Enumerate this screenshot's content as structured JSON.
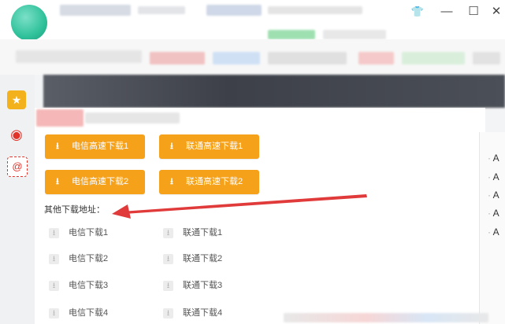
{
  "window": {
    "minimize": "—",
    "maximize": "☐",
    "close": "✕",
    "skin": "👕"
  },
  "rail": {
    "favorites_icon": "star-icon",
    "weibo_icon": "weibo-icon",
    "mail_icon": "at-icon"
  },
  "primary_buttons": [
    {
      "label": "电信高速下载1"
    },
    {
      "label": "联通高速下载1"
    },
    {
      "label": "电信高速下载2"
    },
    {
      "label": "联通高速下载2"
    }
  ],
  "other_label": "其他下载地址：",
  "links": [
    {
      "label": "电信下载1"
    },
    {
      "label": "联通下载1"
    },
    {
      "label": "电信下载2"
    },
    {
      "label": "联通下载2"
    },
    {
      "label": "电信下载3"
    },
    {
      "label": "联通下载3"
    },
    {
      "label": "电信下载4"
    },
    {
      "label": "联通下载4"
    }
  ],
  "side_items": [
    "A",
    "A",
    "A",
    "A",
    "A"
  ],
  "colors": {
    "accent": "#f6a11a",
    "arrow": "#e03a3a"
  }
}
